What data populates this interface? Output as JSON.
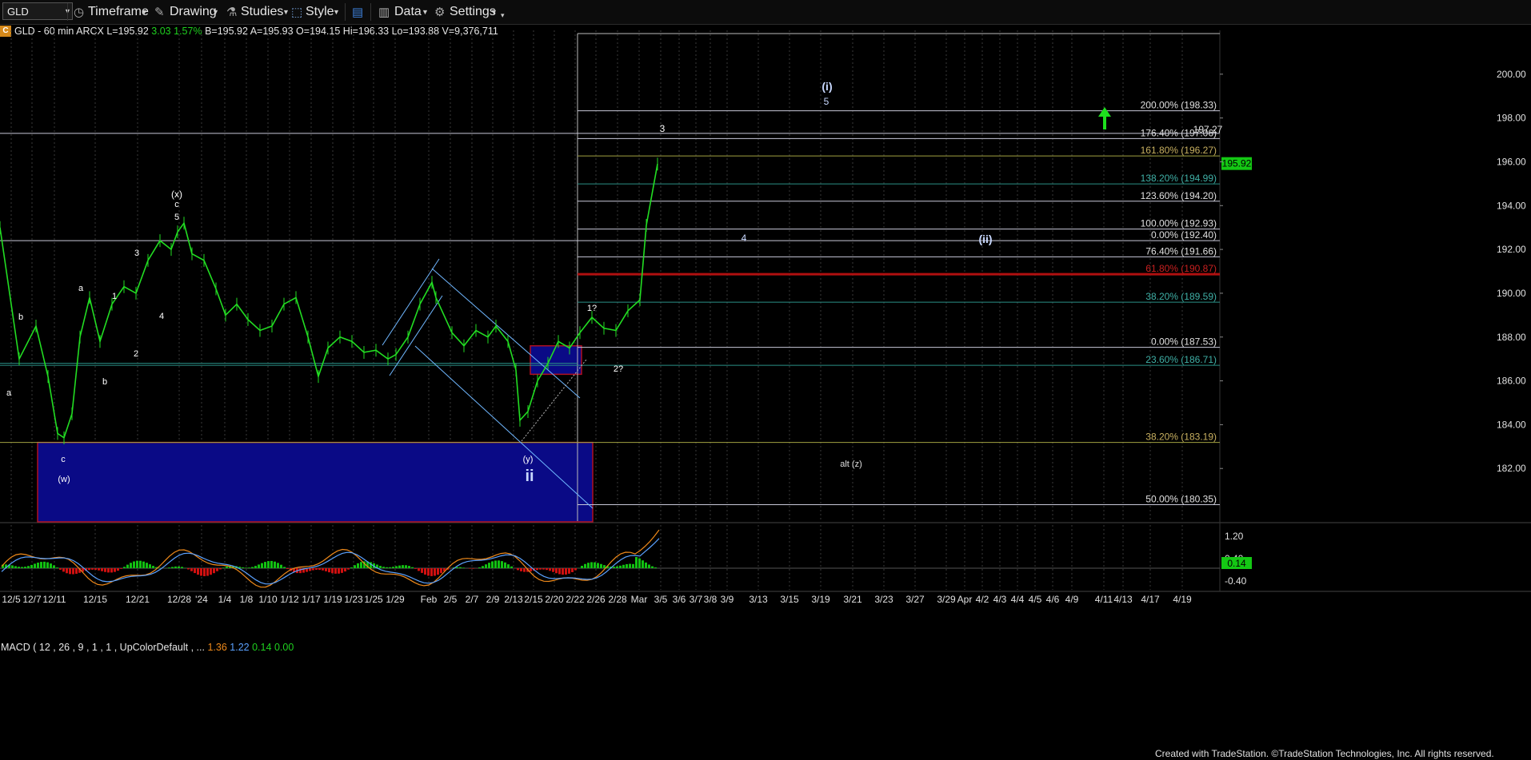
{
  "toolbar": {
    "symbol": "GLD",
    "timeframe": "Timeframe",
    "drawing": "Drawing",
    "studies": "Studies",
    "style": "Style",
    "data": "Data",
    "settings": "Settings"
  },
  "infobar": {
    "badge": "C",
    "title": "GLD - 60 min  ARCX",
    "last": "L=195.92",
    "chg": "3.03",
    "pct": "1.57%",
    "rest": "B=195.92  A=195.93  O=194.15  Hi=196.33  Lo=193.88  V=9,376,711"
  },
  "chart_data": {
    "type": "line",
    "title": "GLD - 60 min ARCX",
    "ylim": [
      179.6,
      202.0
    ],
    "y_ticks": [
      182,
      184,
      186,
      188,
      190,
      192,
      194,
      196,
      198,
      200
    ],
    "y_tick_labels": [
      "182.00",
      "184.00",
      "186.00",
      "188.00",
      "190.00",
      "192.00",
      "194.00",
      "196.00",
      "198.00",
      "200.00"
    ],
    "x_tick_labels": [
      "12/5",
      "12/7",
      "12/11",
      "12/15",
      "12/21",
      "12/28",
      "'24",
      "1/4",
      "1/8",
      "1/10",
      "1/12",
      "1/17",
      "1/19",
      "1/23",
      "1/25",
      "1/29",
      "Feb",
      "2/5",
      "2/7",
      "2/9",
      "2/13",
      "2/15",
      "2/20",
      "2/22",
      "2/26",
      "2/28",
      "Mar",
      "3/5",
      "3/6",
      "3/7",
      "3/8",
      "3/9",
      "3/13",
      "3/15",
      "3/19",
      "3/21",
      "3/23",
      "3/27",
      "3/29",
      "Apr",
      "4/2",
      "4/3",
      "4/4",
      "4/5",
      "4/6",
      "4/9",
      "4/11",
      "4/13",
      "4/17",
      "4/19"
    ],
    "last_price": "195.92",
    "series": [
      {
        "x": [
          "12/4",
          "12/5",
          "12/6",
          "12/7",
          "12/8",
          "12/11",
          "12/12",
          "12/13",
          "12/14",
          "12/15",
          "12/18",
          "12/19",
          "12/20",
          "12/21",
          "12/22",
          "12/26",
          "12/27",
          "12/28",
          "12/29",
          "1/2",
          "1/3",
          "1/4",
          "1/5",
          "1/8",
          "1/9",
          "1/10",
          "1/11",
          "1/12",
          "1/16",
          "1/17",
          "1/18",
          "1/19",
          "1/22",
          "1/23",
          "1/24",
          "1/25",
          "1/26",
          "1/29",
          "1/30",
          "1/31",
          "2/1",
          "2/2",
          "2/5",
          "2/6",
          "2/7",
          "2/8",
          "2/9",
          "2/12",
          "2/13",
          "2/14",
          "2/15",
          "2/16",
          "2/20",
          "2/21",
          "2/22",
          "2/23",
          "2/26",
          "2/27",
          "2/28",
          "2/29",
          "3/1",
          "3/4"
        ],
        "values": [
          193.0,
          187.0,
          188.5,
          186.2,
          183.6,
          183.4,
          184.5,
          188.0,
          189.8,
          187.8,
          189.5,
          190.3,
          190.0,
          191.5,
          192.4,
          192.0,
          192.8,
          193.2,
          191.8,
          191.5,
          190.2,
          189.0,
          189.5,
          188.8,
          188.3,
          188.5,
          189.5,
          189.8,
          188.0,
          186.2,
          187.5,
          188.0,
          187.8,
          187.3,
          187.4,
          187.0,
          187.2,
          188.0,
          189.5,
          190.5,
          189.8,
          188.2,
          187.6,
          188.3,
          188.0,
          188.5,
          187.8,
          186.5,
          184.2,
          184.6,
          186.0,
          186.8,
          187.8,
          187.5,
          188.2,
          188.9,
          188.4,
          188.3,
          189.2,
          189.7,
          193.1,
          195.9
        ]
      }
    ],
    "horizontal_levels": [
      {
        "label": "200.00% (198.33)",
        "value": 198.33
      },
      {
        "label": "176.40% (197.06)",
        "value": 197.06
      },
      {
        "label": "161.80% (196.27)",
        "value": 196.27
      },
      {
        "label": "138.20% (194.99)",
        "value": 194.99
      },
      {
        "label": "123.60% (194.20)",
        "value": 194.2
      },
      {
        "label": "100.00% (192.93)",
        "value": 192.93
      },
      {
        "label": "0.00% (192.40)",
        "value": 192.4
      },
      {
        "label": "76.40% (191.66)",
        "value": 191.66
      },
      {
        "label": "61.80% (190.87)",
        "value": 190.87
      },
      {
        "label": "38.20% (189.59)",
        "value": 189.59
      },
      {
        "label": "0.00% (187.53)",
        "value": 187.53
      },
      {
        "label": "23.60% (186.71)",
        "value": 186.71
      },
      {
        "label": "38.20% (183.19)",
        "value": 183.19
      },
      {
        "label": "50.00% (180.35)",
        "value": 180.35
      }
    ],
    "annotations": [
      "(i)",
      "5",
      "3",
      "197.27",
      "(x)",
      "c",
      "5",
      "3",
      "a",
      "1",
      "b",
      "4",
      "2",
      "a",
      "b",
      "c",
      "(w)",
      "4",
      "(ii)",
      "1?",
      "2?",
      "(y)",
      "ii",
      "alt (z)"
    ]
  },
  "macd": {
    "label": "MACD ( 12 , 26 , 9 , 1 , 1 , UpColorDefault , ...",
    "v1": "1.36",
    "v2": "1.22",
    "v3": "0.14",
    "v4": "0.00",
    "y_tick_labels": [
      "1.20",
      "0.40",
      "-0.40"
    ],
    "last": "0.14"
  },
  "footer": "Created with TradeStation. ©TradeStation Technologies, Inc. All rights reserved.",
  "colors": {
    "price": "#22dd22",
    "fib_red": "#b01010",
    "fib_teal": "#2a8f86",
    "fib_olive": "#a0a040",
    "box_fill": "#0a0a86",
    "box_border": "#b01020",
    "up_arrow": "#1ee01e"
  }
}
